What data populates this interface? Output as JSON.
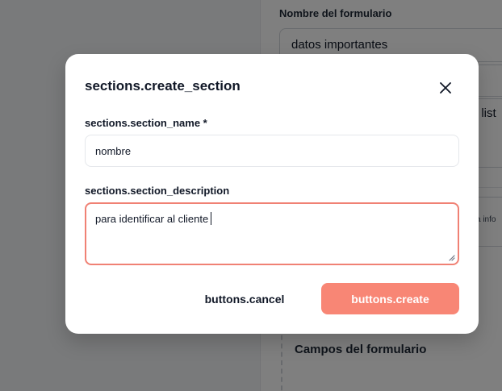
{
  "background": {
    "form_name_label": "Nombre del formulario",
    "form_name_value": "datos importantes",
    "partial_text_1": ": list",
    "partial_text_2": "a info",
    "fields_title": "Campos del formulario"
  },
  "modal": {
    "title": "sections.create_section",
    "close_icon": "close-icon",
    "section_name": {
      "label": "sections.section_name *",
      "value": "nombre"
    },
    "section_description": {
      "label": "sections.section_description",
      "value": "para identificar al cliente"
    },
    "cancel_label": "buttons.cancel",
    "create_label": "buttons.create"
  },
  "colors": {
    "accent": "#f88675",
    "accent_border": "#f08174",
    "overlay": "rgba(0,0,0,0.5)",
    "text": "#111827"
  }
}
